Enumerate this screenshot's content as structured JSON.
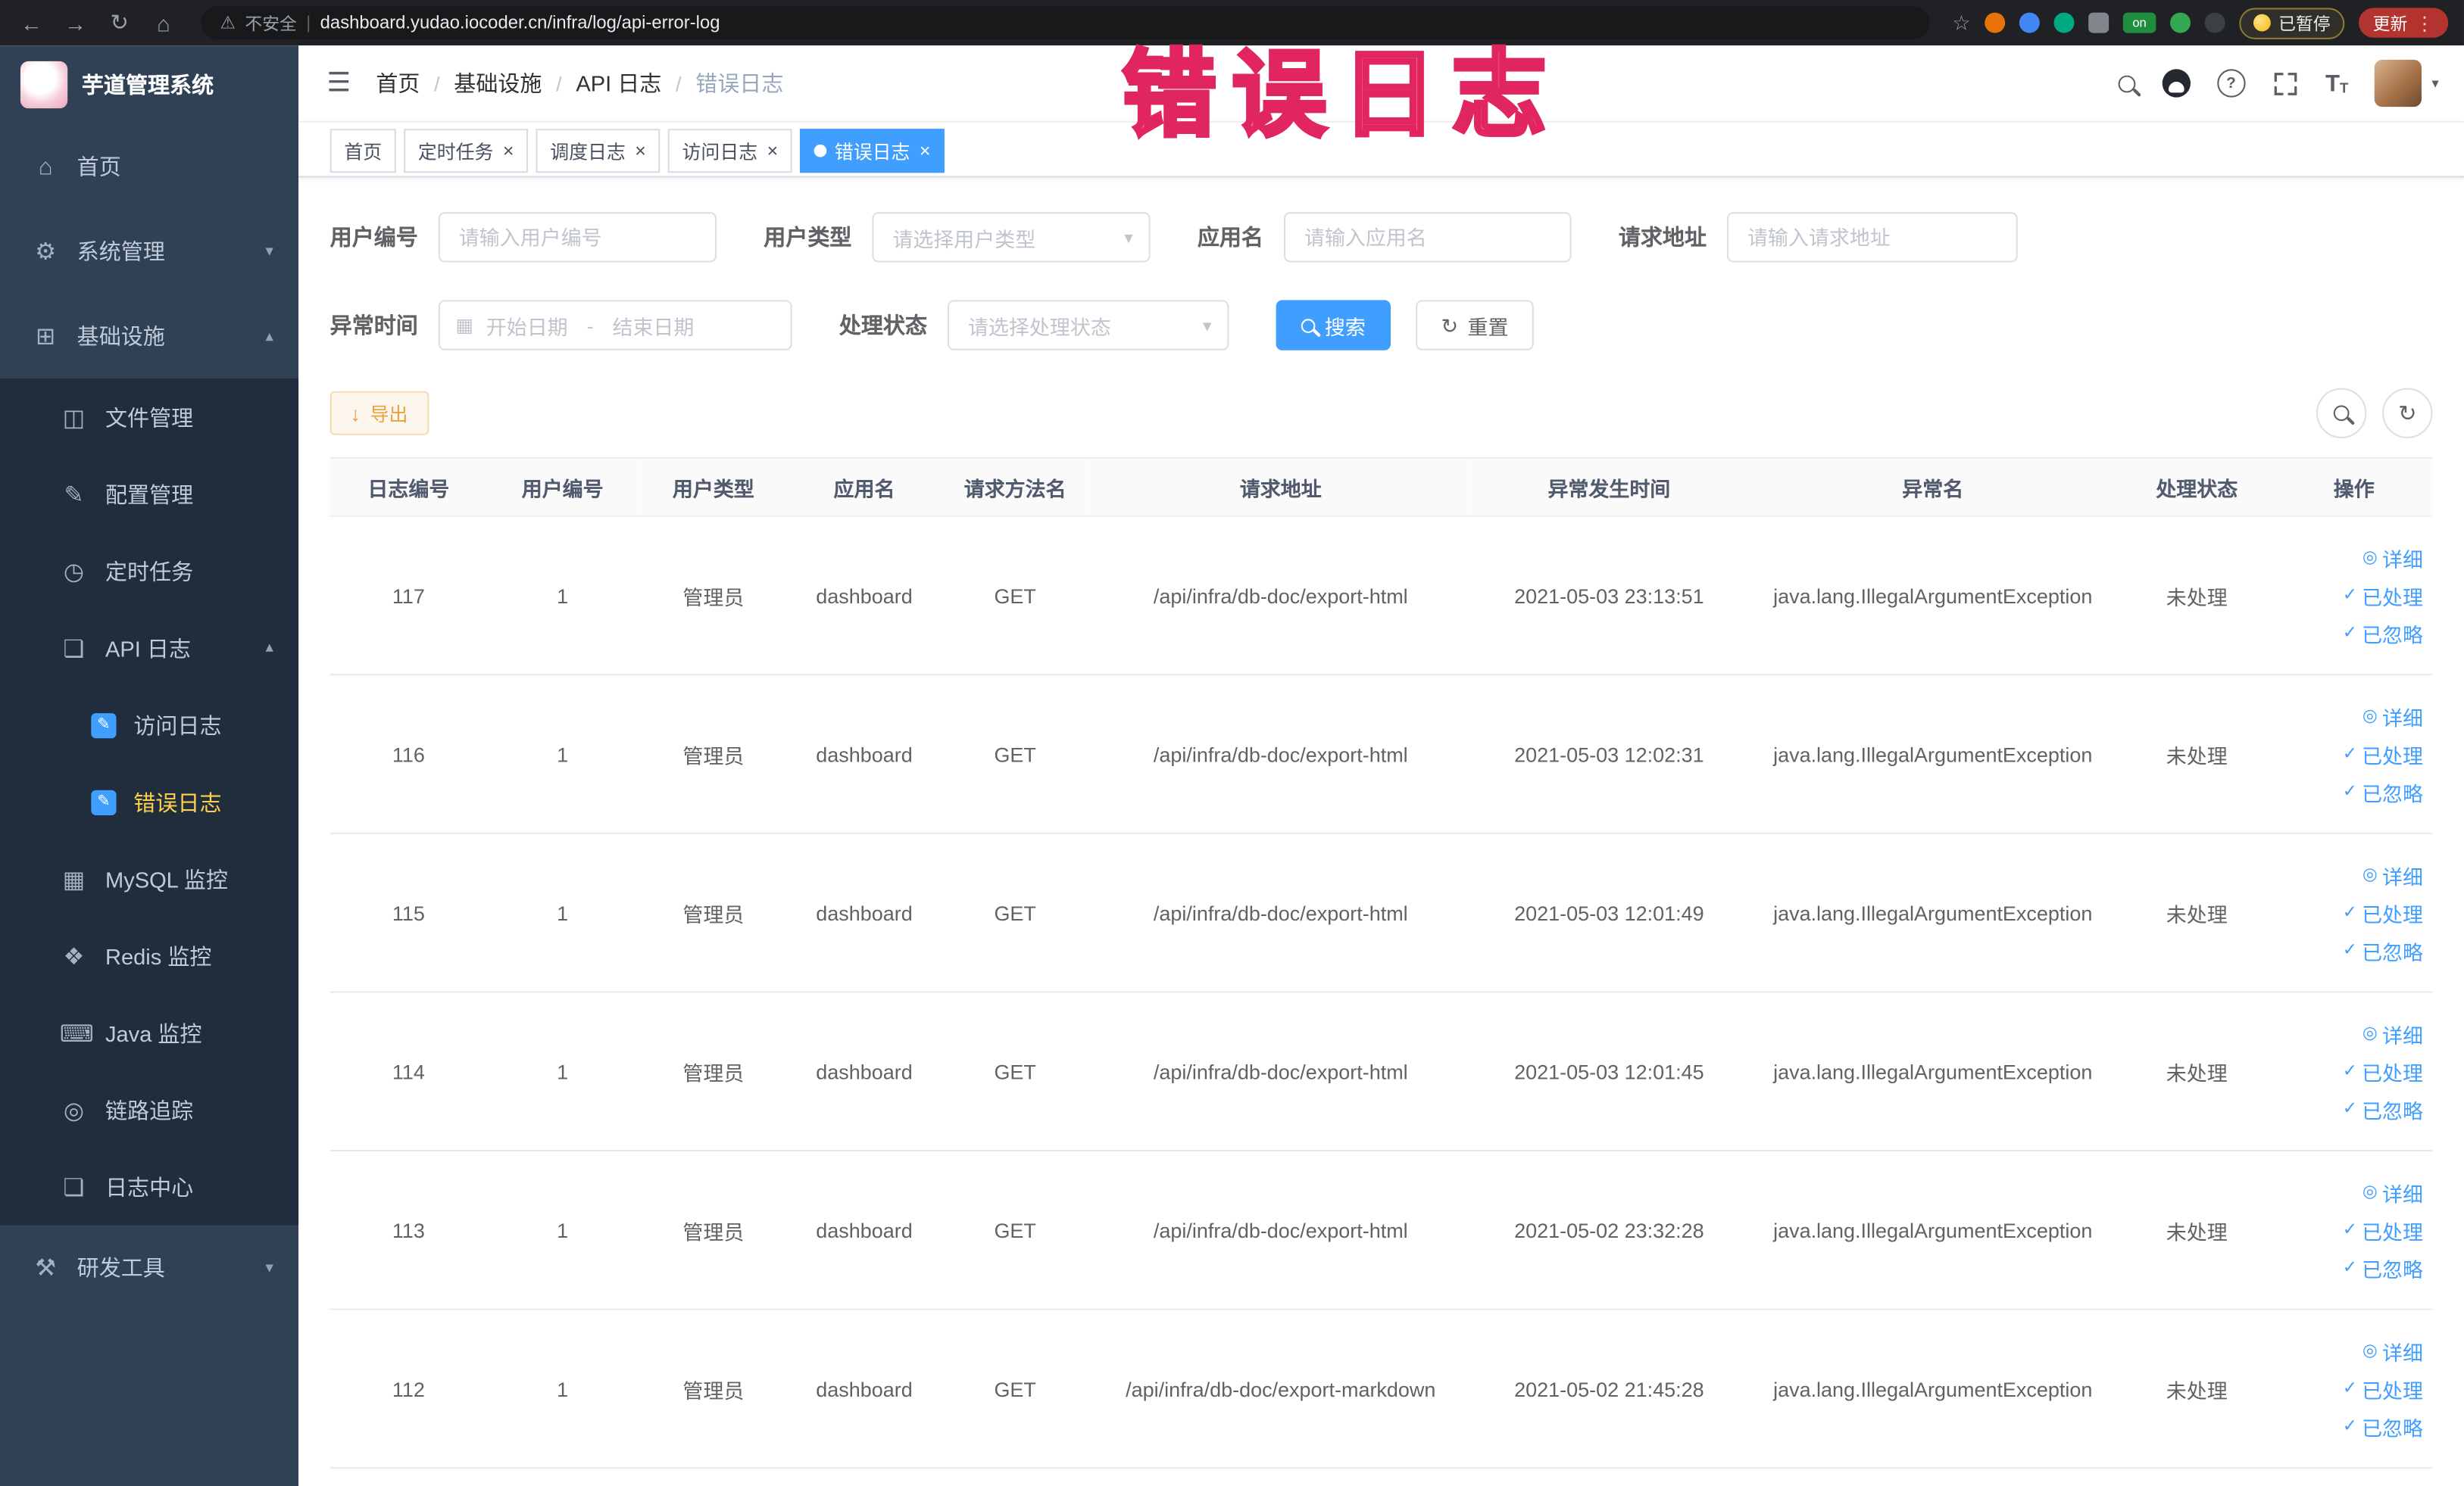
{
  "browser": {
    "security_label": "不安全",
    "url": "dashboard.yudao.iocoder.cn/infra/log/api-error-log",
    "ext_on_label": "on",
    "paused_badge": "已暂停",
    "update_button": "更新"
  },
  "annotation": "错误日志",
  "sidebar": {
    "logo_title": "芋道管理系统",
    "items": [
      {
        "label": "首页"
      },
      {
        "label": "系统管理"
      },
      {
        "label": "基础设施"
      },
      {
        "label": "文件管理"
      },
      {
        "label": "配置管理"
      },
      {
        "label": "定时任务"
      },
      {
        "label": "API 日志"
      },
      {
        "label": "访问日志"
      },
      {
        "label": "错误日志"
      },
      {
        "label": "MySQL 监控"
      },
      {
        "label": "Redis 监控"
      },
      {
        "label": "Java 监控"
      },
      {
        "label": "链路追踪"
      },
      {
        "label": "日志中心"
      },
      {
        "label": "研发工具"
      }
    ]
  },
  "header": {
    "breadcrumb": [
      {
        "label": "首页"
      },
      {
        "label": "基础设施"
      },
      {
        "label": "API 日志"
      },
      {
        "label": "错误日志"
      }
    ]
  },
  "tabs": [
    {
      "label": "首页"
    },
    {
      "label": "定时任务"
    },
    {
      "label": "调度日志"
    },
    {
      "label": "访问日志"
    },
    {
      "label": "错误日志"
    }
  ],
  "filters": {
    "user_id_label": "用户编号",
    "user_id_placeholder": "请输入用户编号",
    "user_type_label": "用户类型",
    "user_type_placeholder": "请选择用户类型",
    "app_name_label": "应用名",
    "app_name_placeholder": "请输入应用名",
    "request_url_label": "请求地址",
    "request_url_placeholder": "请输入请求地址",
    "exception_time_label": "异常时间",
    "date_start_placeholder": "开始日期",
    "date_separator": "-",
    "date_end_placeholder": "结束日期",
    "process_status_label": "处理状态",
    "process_status_placeholder": "请选择处理状态",
    "search_button": "搜索",
    "reset_button": "重置"
  },
  "toolbar": {
    "export_button": "导出"
  },
  "table": {
    "columns": [
      "日志编号",
      "用户编号",
      "用户类型",
      "应用名",
      "请求方法名",
      "请求地址",
      "异常发生时间",
      "异常名",
      "处理状态",
      "操作"
    ],
    "action_labels": {
      "detail": "详细",
      "processed": "已处理",
      "ignored": "已忽略"
    },
    "rows": [
      {
        "id": "117",
        "user_id": "1",
        "user_type": "管理员",
        "app": "dashboard",
        "method": "GET",
        "url": "/api/infra/db-doc/export-html",
        "time": "2021-05-03 23:13:51",
        "exception": "java.lang.IllegalArgumentException",
        "status": "未处理"
      },
      {
        "id": "116",
        "user_id": "1",
        "user_type": "管理员",
        "app": "dashboard",
        "method": "GET",
        "url": "/api/infra/db-doc/export-html",
        "time": "2021-05-03 12:02:31",
        "exception": "java.lang.IllegalArgumentException",
        "status": "未处理"
      },
      {
        "id": "115",
        "user_id": "1",
        "user_type": "管理员",
        "app": "dashboard",
        "method": "GET",
        "url": "/api/infra/db-doc/export-html",
        "time": "2021-05-03 12:01:49",
        "exception": "java.lang.IllegalArgumentException",
        "status": "未处理"
      },
      {
        "id": "114",
        "user_id": "1",
        "user_type": "管理员",
        "app": "dashboard",
        "method": "GET",
        "url": "/api/infra/db-doc/export-html",
        "time": "2021-05-03 12:01:45",
        "exception": "java.lang.IllegalArgumentException",
        "status": "未处理"
      },
      {
        "id": "113",
        "user_id": "1",
        "user_type": "管理员",
        "app": "dashboard",
        "method": "GET",
        "url": "/api/infra/db-doc/export-html",
        "time": "2021-05-02 23:32:28",
        "exception": "java.lang.IllegalArgumentException",
        "status": "未处理"
      },
      {
        "id": "112",
        "user_id": "1",
        "user_type": "管理员",
        "app": "dashboard",
        "method": "GET",
        "url": "/api/infra/db-doc/export-markdown",
        "time": "2021-05-02 21:45:28",
        "exception": "java.lang.IllegalArgumentException",
        "status": "未处理"
      }
    ]
  },
  "icons": {
    "back": "←",
    "forward": "→",
    "reload": "↻",
    "home": "⌂",
    "warning": "⚠",
    "pipe": "|",
    "star": "☆",
    "kebab": "⋮",
    "hamburger": "☰",
    "gear": "⚙",
    "grid": "⊞",
    "folder": "◫",
    "edit": "✎",
    "clock": "◷",
    "doc": "❏",
    "table": "▦",
    "diamond": "❖",
    "keyboard": "⌨",
    "target": "◎",
    "tools": "⚒",
    "chevron_down": "▾",
    "chevron_up": "▴",
    "check": "✓",
    "eye": "◎",
    "close": "×",
    "refresh": "↻",
    "download": "↓",
    "question": "?",
    "slash": "/",
    "calendar": "▦",
    "text_size": "T"
  }
}
